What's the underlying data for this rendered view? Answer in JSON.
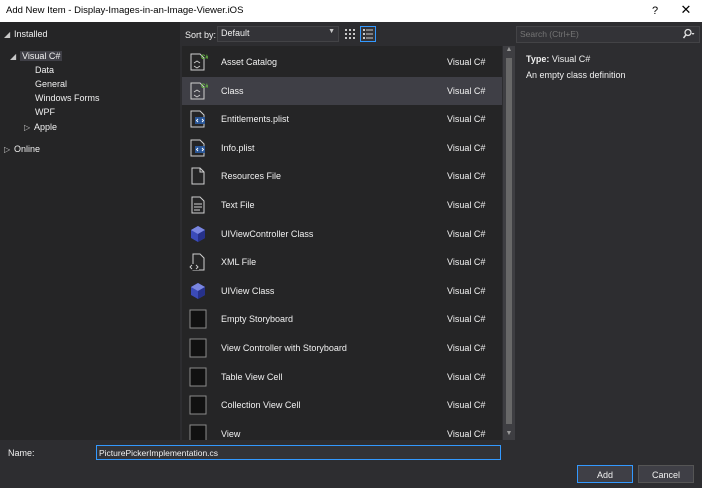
{
  "window": {
    "title": "Add New Item - Display-Images-in-an-Image-Viewer.iOS",
    "help_label": "?",
    "close_label": "✕"
  },
  "tree": {
    "installed": "Installed",
    "visual_csharp": "Visual C#",
    "children": [
      "Data",
      "General",
      "Windows Forms",
      "WPF"
    ],
    "apple": "Apple",
    "online": "Online"
  },
  "toolbar": {
    "sort_label": "Sort by:",
    "sort_value": "Default"
  },
  "search": {
    "placeholder": "Search (Ctrl+E)"
  },
  "templates": [
    {
      "name": "Asset Catalog",
      "lang": "Visual C#",
      "icon": "csharp-file-icon"
    },
    {
      "name": "Class",
      "lang": "Visual C#",
      "icon": "csharp-file-icon"
    },
    {
      "name": "Entitlements.plist",
      "lang": "Visual C#",
      "icon": "plist-file-icon"
    },
    {
      "name": "Info.plist",
      "lang": "Visual C#",
      "icon": "plist-file-icon"
    },
    {
      "name": "Resources File",
      "lang": "Visual C#",
      "icon": "resource-file-icon"
    },
    {
      "name": "Text File",
      "lang": "Visual C#",
      "icon": "text-file-icon"
    },
    {
      "name": "UIViewController Class",
      "lang": "Visual C#",
      "icon": "cube-icon"
    },
    {
      "name": "XML File",
      "lang": "Visual C#",
      "icon": "xml-file-icon"
    },
    {
      "name": "UIView Class",
      "lang": "Visual C#",
      "icon": "cube-icon"
    },
    {
      "name": "Empty Storyboard",
      "lang": "Visual C#",
      "icon": "storyboard-icon"
    },
    {
      "name": "View Controller with Storyboard",
      "lang": "Visual C#",
      "icon": "storyboard-icon"
    },
    {
      "name": "Table View Cell",
      "lang": "Visual C#",
      "icon": "storyboard-icon"
    },
    {
      "name": "Collection View Cell",
      "lang": "Visual C#",
      "icon": "storyboard-icon"
    },
    {
      "name": "View",
      "lang": "Visual C#",
      "icon": "storyboard-icon"
    }
  ],
  "selected_index": 1,
  "details": {
    "type_key": "Type:",
    "type_value": "Visual C#",
    "description": "An empty class definition"
  },
  "footer": {
    "name_label": "Name:",
    "name_value": "PicturePickerImplementation.cs",
    "add_label": "Add",
    "cancel_label": "Cancel"
  },
  "colors": {
    "background": "#2d2d30",
    "panel": "#252526",
    "selection": "#3f3f46",
    "accent": "#3399ff",
    "csharp_badge": "#6abe45",
    "cube": "#3b4bb8"
  }
}
